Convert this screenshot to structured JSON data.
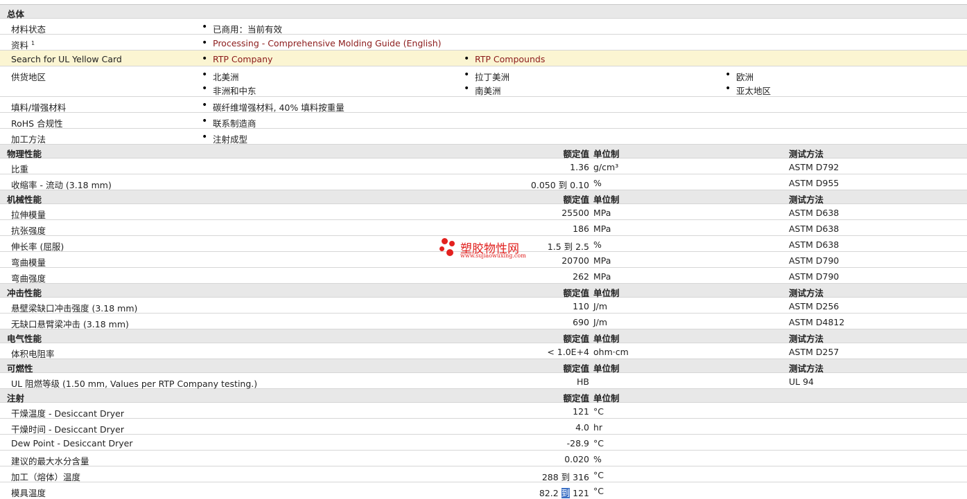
{
  "general": {
    "title": "总体",
    "material_status": {
      "label": "材料状态",
      "value": "已商用：当前有效"
    },
    "resources": {
      "label": "资料",
      "sup": "1",
      "link": "Processing - Comprehensive Molding Guide (English)"
    },
    "ul_card": {
      "label": "Search for UL Yellow Card",
      "link1": "RTP Company",
      "link2": "RTP Compounds"
    },
    "supply": {
      "label": "供货地区",
      "r1": [
        "北美洲",
        "拉丁美洲",
        "欧洲"
      ],
      "r2": [
        "非洲和中东",
        "南美洲",
        "亚太地区"
      ]
    },
    "filler": {
      "label": "填料/增强材料",
      "value": "碳纤维增强材料, 40% 填料按重量"
    },
    "rohs": {
      "label": "RoHS 合规性",
      "value": "联系制造商"
    },
    "process": {
      "label": "加工方法",
      "value": "注射成型"
    }
  },
  "headers": {
    "value": "额定值",
    "unit": "单位制",
    "test": "测试方法"
  },
  "physical": {
    "title": "物理性能",
    "rows": [
      {
        "label": "比重",
        "value": "1.36",
        "unit": "g/cm³",
        "test": "ASTM D792"
      },
      {
        "label": "收缩率  - 流动  (3.18 mm)",
        "value": "0.050 到  0.10",
        "unit": "%",
        "test": "ASTM D955"
      }
    ]
  },
  "mechanical": {
    "title": "机械性能",
    "rows": [
      {
        "label": "拉伸模量",
        "value": "25500",
        "unit": "MPa",
        "test": "ASTM D638"
      },
      {
        "label": "抗张强度",
        "value": "186",
        "unit": "MPa",
        "test": "ASTM D638"
      },
      {
        "label": "伸长率  (屈服)",
        "value": "1.5 到  2.5",
        "unit": "%",
        "test": "ASTM D638"
      },
      {
        "label": "弯曲模量",
        "value": "20700",
        "unit": "MPa",
        "test": "ASTM D790"
      },
      {
        "label": "弯曲强度",
        "value": "262",
        "unit": "MPa",
        "test": "ASTM D790"
      }
    ]
  },
  "impact": {
    "title": "冲击性能",
    "rows": [
      {
        "label": "悬壁梁缺口冲击强度  (3.18 mm)",
        "value": "110",
        "unit": "J/m",
        "test": "ASTM D256"
      },
      {
        "label": "无缺口悬臂梁冲击  (3.18 mm)",
        "value": "690",
        "unit": "J/m",
        "test": "ASTM D4812"
      }
    ]
  },
  "electrical": {
    "title": "电气性能",
    "rows": [
      {
        "label": "体积电阻率",
        "value": "< 1.0E+4",
        "unit": "ohm·cm",
        "test": "ASTM D257"
      }
    ]
  },
  "flammability": {
    "title": "可燃性",
    "rows": [
      {
        "label": "UL 阻燃等级  (1.50 mm, Values per RTP Company testing.)",
        "value": "HB",
        "unit": "",
        "test": "UL 94"
      }
    ]
  },
  "injection": {
    "title": "注射",
    "rows": [
      {
        "label": "干燥温度  - Desiccant Dryer",
        "value": "121",
        "unit": "°C"
      },
      {
        "label": "干燥时间  - Desiccant Dryer",
        "value": "4.0",
        "unit": "hr"
      },
      {
        "label": "Dew Point - Desiccant Dryer",
        "value": "-28.9",
        "unit": "°C"
      },
      {
        "label": "建议的最大水分含量",
        "value": "0.020",
        "unit": "%"
      },
      {
        "label": "加工（熔体）温度",
        "value": "288 到  316",
        "unit": "°C"
      }
    ],
    "mold_temp": {
      "label": "模具温度",
      "v1": "82.2",
      "sel": "到",
      "v2": "121",
      "unit": "°C"
    }
  },
  "watermark": {
    "title": "塑胶物性网",
    "url": "www.sujiaowuxing.com",
    "color": "#e0201e"
  }
}
